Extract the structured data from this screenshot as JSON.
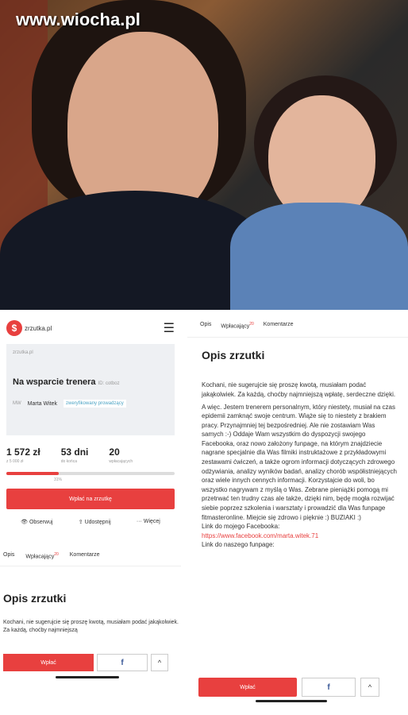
{
  "watermark": "www.wiocha.pl",
  "left": {
    "logo_text": "zrzutka.pl",
    "card_logo": "zrzutka.pl",
    "title": "Na wsparcie trenera",
    "id_label": "ID: cotboz",
    "author_initials": "MW",
    "author": "Marta Witek",
    "verified": "zweryfikowany prowadzący",
    "stats": [
      {
        "value": "1 572 zł",
        "label": "z 5 000 zł"
      },
      {
        "value": "53 dni",
        "label": "do końca"
      },
      {
        "value": "20",
        "label": "wpłacających"
      }
    ],
    "progress_percent": 31,
    "progress_label": "31%",
    "pay_button": "Wpłać na zrzutkę",
    "actions": [
      "Obserwuj",
      "Udostępnij",
      "Więcej"
    ],
    "tabs": [
      "Opis",
      "Wpłacający",
      "Komentarze"
    ],
    "tab_count": "20",
    "heading": "Opis zrzutki",
    "text_preview": "Kochani, nie sugerujcie się proszę kwotą, musiałam podać jakąkolwiek. Za każdą, choćby najmniejszą",
    "bottom_pay": "Wpłać",
    "bottom_fb": "f",
    "bottom_up": "^"
  },
  "right": {
    "tabs": [
      "Opis",
      "Wpłacający",
      "Komentarze"
    ],
    "tab_count": "20",
    "heading": "Opis zrzutki",
    "paragraphs": [
      "Kochani, nie sugerujcie się proszę kwotą, musiałam podać jakąkolwiek. Za każdą, choćby najmniejszą wpłatę, serdeczne dzięki.",
      "A więc. Jestem trenerem personalnym, który niestety, musiał na czas epidemii zamknąć swoje centrum. Wiąże się to niestety z brakiem pracy. Przynajmniej tej bezpośredniej. Ale nie zostawiam Was samych :-) Oddaje Wam wszystkim do dyspozycji swojego Facebooka, oraz nowo założony funpage, na którym znajdziecie nagrane specjalnie dla Was filmiki instruktażowe z przykładowymi zestawami ćwiczeń, a także ogrom informacji dotyczących zdrowego odżywiania, analizy wyników badań, analizy chorób współistniejących oraz wiele innych cennych informacji. Korzystajcie do woli, bo wszystko nagrywam z myślą o Was. Zebrane pieniążki pomogą mi przetrwać ten trudny czas ale także, dzięki nim, będę mogła rozwijać siebie poprzez szkolenia i warsztaty i prowadzić dla Was funpage fitmasteronline. Miejcie się zdrowo i pięknie :) BUZIAKI :)",
      "Link do mojego Facebooka:",
      "https://www.facebook.com/marta.witek.71",
      "Link do naszego funpage:"
    ],
    "bottom_pay": "Wpłać",
    "bottom_fb": "f",
    "bottom_up": "^"
  }
}
